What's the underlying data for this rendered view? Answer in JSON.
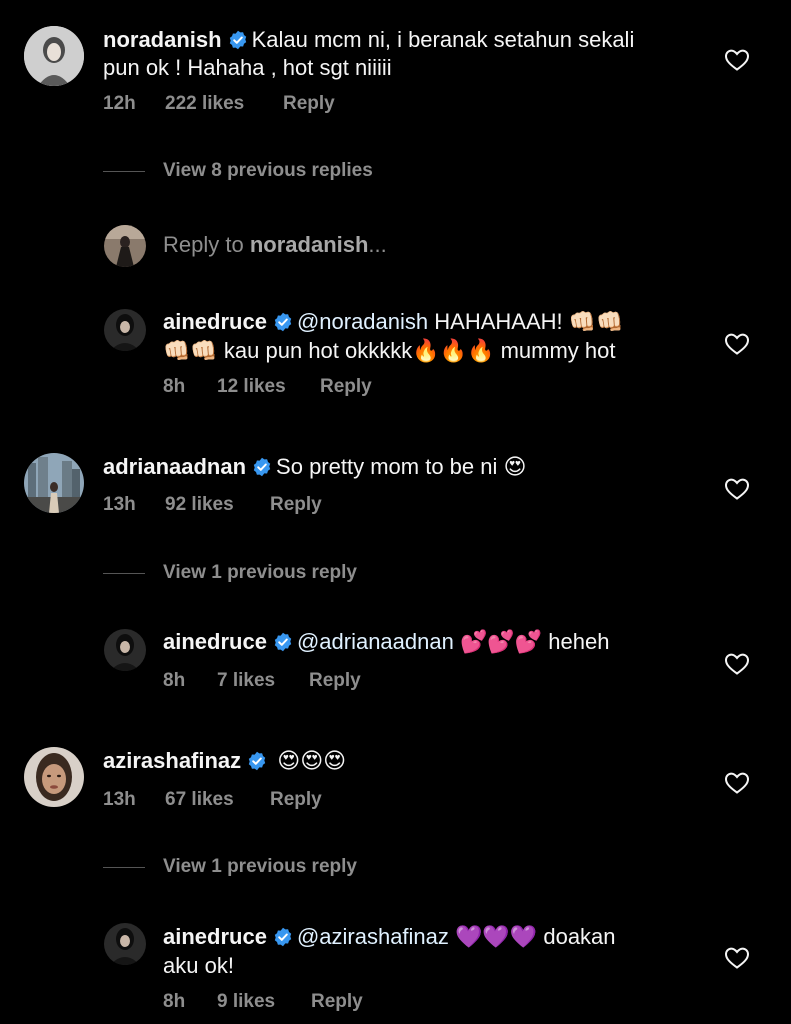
{
  "comments": [
    {
      "username": "noradanish",
      "text": "Kalau mcm ni, i beranak setahun sekali",
      "text2": "pun ok ! Hahaha , hot sgt niiiii",
      "time": "12h",
      "likes": "222 likes",
      "reply": "Reply"
    },
    {
      "username": "adrianaadnan",
      "text": "So pretty mom to be ni",
      "emoji": "😍",
      "time": "13h",
      "likes": "92 likes",
      "reply": "Reply"
    },
    {
      "username": "azirashafinaz",
      "emoji": "😍😍😍",
      "time": "13h",
      "likes": "67 likes",
      "reply": "Reply"
    }
  ],
  "view_replies": [
    "View 8 previous replies",
    "View 1 previous reply",
    "View 1 previous reply"
  ],
  "reply_input": {
    "prefix": "Reply to",
    "target": "noradanish",
    "suffix": "..."
  },
  "replies": [
    {
      "username": "ainedruce",
      "mention": "@noradanish",
      "text": "HAHAHAAH!",
      "emoji1": "👊🏻👊🏻",
      "emoji2": "👊🏻👊🏻",
      "text2": "kau pun hot okkkkk",
      "emoji3": "🔥🔥🔥",
      "text3": "mummy hot",
      "time": "8h",
      "likes": "12 likes",
      "reply": "Reply"
    },
    {
      "username": "ainedruce",
      "mention": "@adrianaadnan",
      "emoji": "💕💕💕",
      "text": "heheh",
      "time": "8h",
      "likes": "7 likes",
      "reply": "Reply"
    },
    {
      "username": "ainedruce",
      "mention": "@azirashafinaz",
      "emoji": "💜💜💜",
      "text": "doakan",
      "text2": "aku ok!",
      "time": "8h",
      "likes": "9 likes",
      "reply": "Reply"
    }
  ],
  "colors": {
    "background": "#000000",
    "text": "#f5f5f5",
    "muted": "#8e8e8e",
    "verified": "#3897f0"
  }
}
